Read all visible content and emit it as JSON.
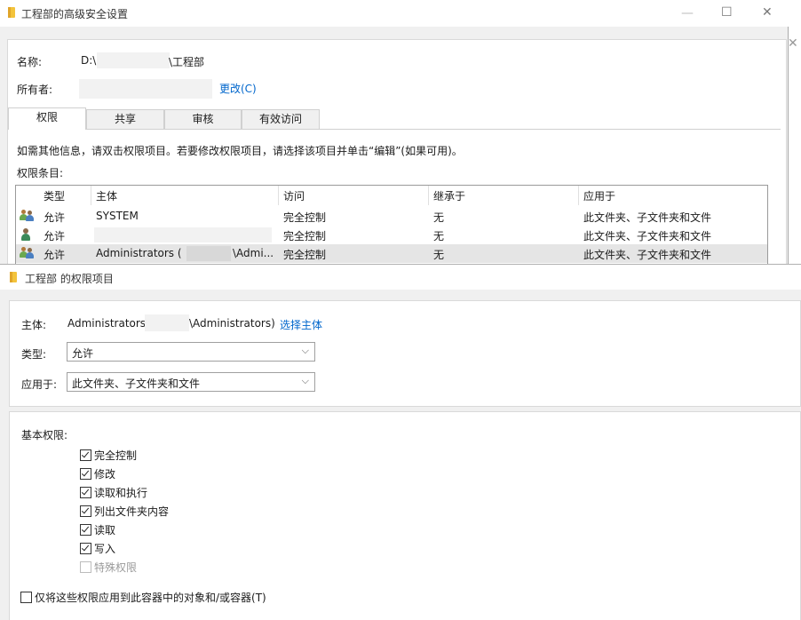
{
  "back_window": {
    "title": "工程部的高级安全设置",
    "name_label": "名称:",
    "path_prefix": "D:\\",
    "path_suffix": "\\工程部",
    "owner_label": "所有者:",
    "change_link": "更改(C)",
    "tabs": [
      {
        "label": "权限",
        "active": true
      },
      {
        "label": "共享",
        "active": false
      },
      {
        "label": "审核",
        "active": false
      },
      {
        "label": "有效访问",
        "active": false
      }
    ],
    "info_text": "如需其他信息，请双击权限项目。若要修改权限项目，请选择该项目并单击“编辑”(如果可用)。",
    "entries_label": "权限条目:",
    "columns": [
      "类型",
      "主体",
      "访问",
      "继承于",
      "应用于"
    ],
    "rows": [
      {
        "type": "允许",
        "principal": "SYSTEM",
        "access": "完全控制",
        "inherited_from": "无",
        "applies_to": "此文件夹、子文件夹和文件",
        "icon": "group-users-icon",
        "selected": false
      },
      {
        "type": "允许",
        "principal": "",
        "access": "完全控制",
        "inherited_from": "无",
        "applies_to": "此文件夹、子文件夹和文件",
        "icon": "user-icon",
        "selected": false
      },
      {
        "type": "允许",
        "principal": "Administrators (",
        "principal_tail": "\\Admi...",
        "access": "完全控制",
        "inherited_from": "无",
        "applies_to": "此文件夹、子文件夹和文件",
        "icon": "group-users-icon",
        "selected": true
      }
    ]
  },
  "front_window": {
    "title": "工程部 的权限项目",
    "principal_label": "主体:",
    "principal_prefix": "Administrators (",
    "principal_suffix": "\\Administrators)",
    "select_principal_link": "选择主体",
    "type_label": "类型:",
    "type_value": "允许",
    "applies_label": "应用于:",
    "applies_value": "此文件夹、子文件夹和文件",
    "basic_permissions_label": "基本权限:",
    "permissions": [
      {
        "label": "完全控制",
        "checked": true,
        "enabled": true
      },
      {
        "label": "修改",
        "checked": true,
        "enabled": true
      },
      {
        "label": "读取和执行",
        "checked": true,
        "enabled": true
      },
      {
        "label": "列出文件夹内容",
        "checked": true,
        "enabled": true
      },
      {
        "label": "读取",
        "checked": true,
        "enabled": true
      },
      {
        "label": "写入",
        "checked": true,
        "enabled": true
      },
      {
        "label": "特殊权限",
        "checked": false,
        "enabled": false
      }
    ],
    "apply_only_label": "仅将这些权限应用到此容器中的对象和/或容器(T)",
    "apply_only_checked": false
  },
  "colors": {
    "link": "#0066cc",
    "selected_row": "#e5e5e5",
    "folder": "#f3c33b"
  }
}
